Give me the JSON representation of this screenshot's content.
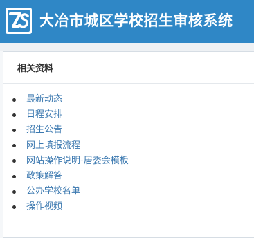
{
  "header": {
    "title": "大冶市城区学校招生审核系统",
    "logo_icon": "zs-logo-icon",
    "logo_text": "ZS",
    "background_color": "#2f87c6"
  },
  "panel": {
    "heading": "相关资料",
    "links": [
      {
        "label": "最新动态"
      },
      {
        "label": "日程安排"
      },
      {
        "label": "招生公告"
      },
      {
        "label": "网上填报流程"
      },
      {
        "label": "网站操作说明-居委会模板"
      },
      {
        "label": "政策解答"
      },
      {
        "label": "公办学校名单"
      },
      {
        "label": "操作视频"
      }
    ],
    "link_color": "#3c79b0"
  }
}
